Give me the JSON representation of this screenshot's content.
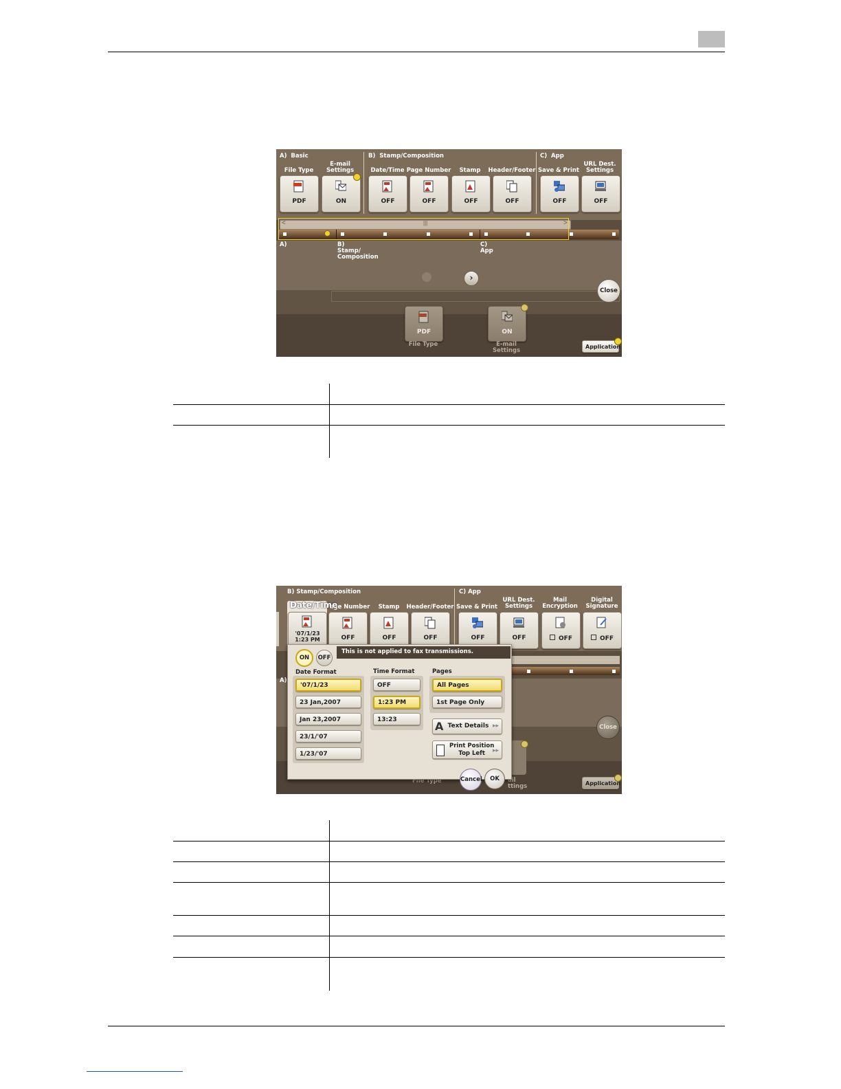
{
  "screen1": {
    "sections": [
      {
        "key": "A)",
        "label": "Basic"
      },
      {
        "key": "B)",
        "label": "Stamp/Composition"
      },
      {
        "key": "C)",
        "label": "App"
      }
    ],
    "buttons": [
      {
        "label": "File Type",
        "value": "PDF",
        "icon": "pdf-file-icon"
      },
      {
        "label": "E-mail\nSettings",
        "value": "ON",
        "icon": "email-settings-icon"
      },
      {
        "label": "Date/Time",
        "value": "OFF",
        "icon": "date-time-stamp-icon"
      },
      {
        "label": "Page Number",
        "value": "OFF",
        "icon": "page-number-icon"
      },
      {
        "label": "Stamp",
        "value": "OFF",
        "icon": "stamp-icon"
      },
      {
        "label": "Header/Footer",
        "value": "OFF",
        "icon": "header-footer-icon"
      },
      {
        "label": "Save & Print",
        "value": "OFF",
        "icon": "save-print-icon"
      },
      {
        "label": "URL Dest.\nSettings",
        "value": "OFF",
        "icon": "url-dest-icon"
      }
    ],
    "track_labels": [
      "A)",
      "B)\nStamp/\nComposition",
      "C)\nApp"
    ],
    "bottom_buttons": [
      {
        "value": "PDF",
        "caption": "File Type"
      },
      {
        "value": "ON",
        "caption": "E-mail\nSettings"
      }
    ],
    "close_label": "Close",
    "application_label": "Application"
  },
  "screen2": {
    "section_b": "B)  Stamp/Composition",
    "section_c": "C)  App",
    "active_tab": "Date/Time",
    "active_value": "'07/1/23\n1:23 PM",
    "tabs": [
      {
        "label": "Page Number",
        "value": "OFF"
      },
      {
        "label": "Stamp",
        "value": "OFF"
      },
      {
        "label": "Header/Footer",
        "value": "OFF"
      },
      {
        "label": "Save & Print",
        "value": "OFF"
      },
      {
        "label": "URL Dest.\nSettings",
        "value": "OFF"
      },
      {
        "label": "Mail\nEncryption",
        "value": "OFF"
      },
      {
        "label": "Digital\nSignature",
        "value": "OFF"
      }
    ],
    "on_label": "ON",
    "off_label": "OFF",
    "notice": "This is not applied to fax transmissions.",
    "date_format_title": "Date Format",
    "date_formats": [
      "'07/1/23",
      "23 Jan,2007",
      "Jan 23,2007",
      "23/1/'07",
      "1/23/'07"
    ],
    "time_format_title": "Time Format",
    "time_formats": [
      "OFF",
      "1:23 PM",
      "13:23"
    ],
    "pages_title": "Pages",
    "pages": [
      "All Pages",
      "1st Page Only"
    ],
    "text_details": "Text Details",
    "print_position": "Print Position\nTop Left",
    "cancel_label": "Cancel",
    "ok_label": "OK",
    "close_label": "Close",
    "application_label": "Application",
    "file_type_caption": "File Type",
    "email_caption": "ail\nttings"
  },
  "colors": {
    "panel_bg": "#7a6b5a",
    "selected_yellow": "#f2dc6e",
    "indicator": "#f2d230"
  }
}
